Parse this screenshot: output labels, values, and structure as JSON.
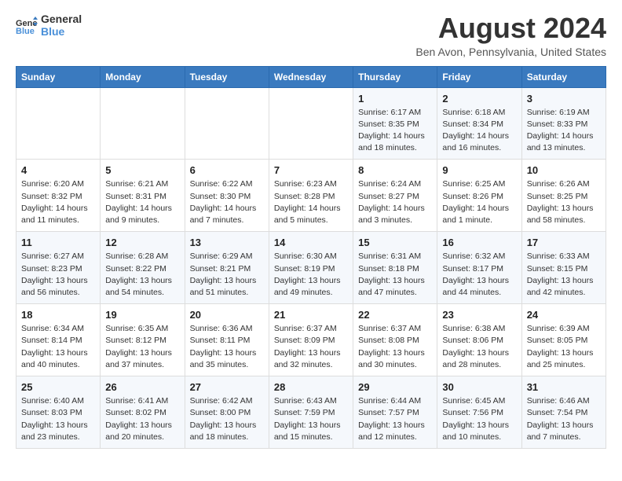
{
  "logo": {
    "line1": "General",
    "line2": "Blue"
  },
  "title": "August 2024",
  "location": "Ben Avon, Pennsylvania, United States",
  "days_of_week": [
    "Sunday",
    "Monday",
    "Tuesday",
    "Wednesday",
    "Thursday",
    "Friday",
    "Saturday"
  ],
  "weeks": [
    [
      {
        "day": "",
        "info": ""
      },
      {
        "day": "",
        "info": ""
      },
      {
        "day": "",
        "info": ""
      },
      {
        "day": "",
        "info": ""
      },
      {
        "day": "1",
        "info": "Sunrise: 6:17 AM\nSunset: 8:35 PM\nDaylight: 14 hours\nand 18 minutes."
      },
      {
        "day": "2",
        "info": "Sunrise: 6:18 AM\nSunset: 8:34 PM\nDaylight: 14 hours\nand 16 minutes."
      },
      {
        "day": "3",
        "info": "Sunrise: 6:19 AM\nSunset: 8:33 PM\nDaylight: 14 hours\nand 13 minutes."
      }
    ],
    [
      {
        "day": "4",
        "info": "Sunrise: 6:20 AM\nSunset: 8:32 PM\nDaylight: 14 hours\nand 11 minutes."
      },
      {
        "day": "5",
        "info": "Sunrise: 6:21 AM\nSunset: 8:31 PM\nDaylight: 14 hours\nand 9 minutes."
      },
      {
        "day": "6",
        "info": "Sunrise: 6:22 AM\nSunset: 8:30 PM\nDaylight: 14 hours\nand 7 minutes."
      },
      {
        "day": "7",
        "info": "Sunrise: 6:23 AM\nSunset: 8:28 PM\nDaylight: 14 hours\nand 5 minutes."
      },
      {
        "day": "8",
        "info": "Sunrise: 6:24 AM\nSunset: 8:27 PM\nDaylight: 14 hours\nand 3 minutes."
      },
      {
        "day": "9",
        "info": "Sunrise: 6:25 AM\nSunset: 8:26 PM\nDaylight: 14 hours\nand 1 minute."
      },
      {
        "day": "10",
        "info": "Sunrise: 6:26 AM\nSunset: 8:25 PM\nDaylight: 13 hours\nand 58 minutes."
      }
    ],
    [
      {
        "day": "11",
        "info": "Sunrise: 6:27 AM\nSunset: 8:23 PM\nDaylight: 13 hours\nand 56 minutes."
      },
      {
        "day": "12",
        "info": "Sunrise: 6:28 AM\nSunset: 8:22 PM\nDaylight: 13 hours\nand 54 minutes."
      },
      {
        "day": "13",
        "info": "Sunrise: 6:29 AM\nSunset: 8:21 PM\nDaylight: 13 hours\nand 51 minutes."
      },
      {
        "day": "14",
        "info": "Sunrise: 6:30 AM\nSunset: 8:19 PM\nDaylight: 13 hours\nand 49 minutes."
      },
      {
        "day": "15",
        "info": "Sunrise: 6:31 AM\nSunset: 8:18 PM\nDaylight: 13 hours\nand 47 minutes."
      },
      {
        "day": "16",
        "info": "Sunrise: 6:32 AM\nSunset: 8:17 PM\nDaylight: 13 hours\nand 44 minutes."
      },
      {
        "day": "17",
        "info": "Sunrise: 6:33 AM\nSunset: 8:15 PM\nDaylight: 13 hours\nand 42 minutes."
      }
    ],
    [
      {
        "day": "18",
        "info": "Sunrise: 6:34 AM\nSunset: 8:14 PM\nDaylight: 13 hours\nand 40 minutes."
      },
      {
        "day": "19",
        "info": "Sunrise: 6:35 AM\nSunset: 8:12 PM\nDaylight: 13 hours\nand 37 minutes."
      },
      {
        "day": "20",
        "info": "Sunrise: 6:36 AM\nSunset: 8:11 PM\nDaylight: 13 hours\nand 35 minutes."
      },
      {
        "day": "21",
        "info": "Sunrise: 6:37 AM\nSunset: 8:09 PM\nDaylight: 13 hours\nand 32 minutes."
      },
      {
        "day": "22",
        "info": "Sunrise: 6:37 AM\nSunset: 8:08 PM\nDaylight: 13 hours\nand 30 minutes."
      },
      {
        "day": "23",
        "info": "Sunrise: 6:38 AM\nSunset: 8:06 PM\nDaylight: 13 hours\nand 28 minutes."
      },
      {
        "day": "24",
        "info": "Sunrise: 6:39 AM\nSunset: 8:05 PM\nDaylight: 13 hours\nand 25 minutes."
      }
    ],
    [
      {
        "day": "25",
        "info": "Sunrise: 6:40 AM\nSunset: 8:03 PM\nDaylight: 13 hours\nand 23 minutes."
      },
      {
        "day": "26",
        "info": "Sunrise: 6:41 AM\nSunset: 8:02 PM\nDaylight: 13 hours\nand 20 minutes."
      },
      {
        "day": "27",
        "info": "Sunrise: 6:42 AM\nSunset: 8:00 PM\nDaylight: 13 hours\nand 18 minutes."
      },
      {
        "day": "28",
        "info": "Sunrise: 6:43 AM\nSunset: 7:59 PM\nDaylight: 13 hours\nand 15 minutes."
      },
      {
        "day": "29",
        "info": "Sunrise: 6:44 AM\nSunset: 7:57 PM\nDaylight: 13 hours\nand 12 minutes."
      },
      {
        "day": "30",
        "info": "Sunrise: 6:45 AM\nSunset: 7:56 PM\nDaylight: 13 hours\nand 10 minutes."
      },
      {
        "day": "31",
        "info": "Sunrise: 6:46 AM\nSunset: 7:54 PM\nDaylight: 13 hours\nand 7 minutes."
      }
    ]
  ]
}
